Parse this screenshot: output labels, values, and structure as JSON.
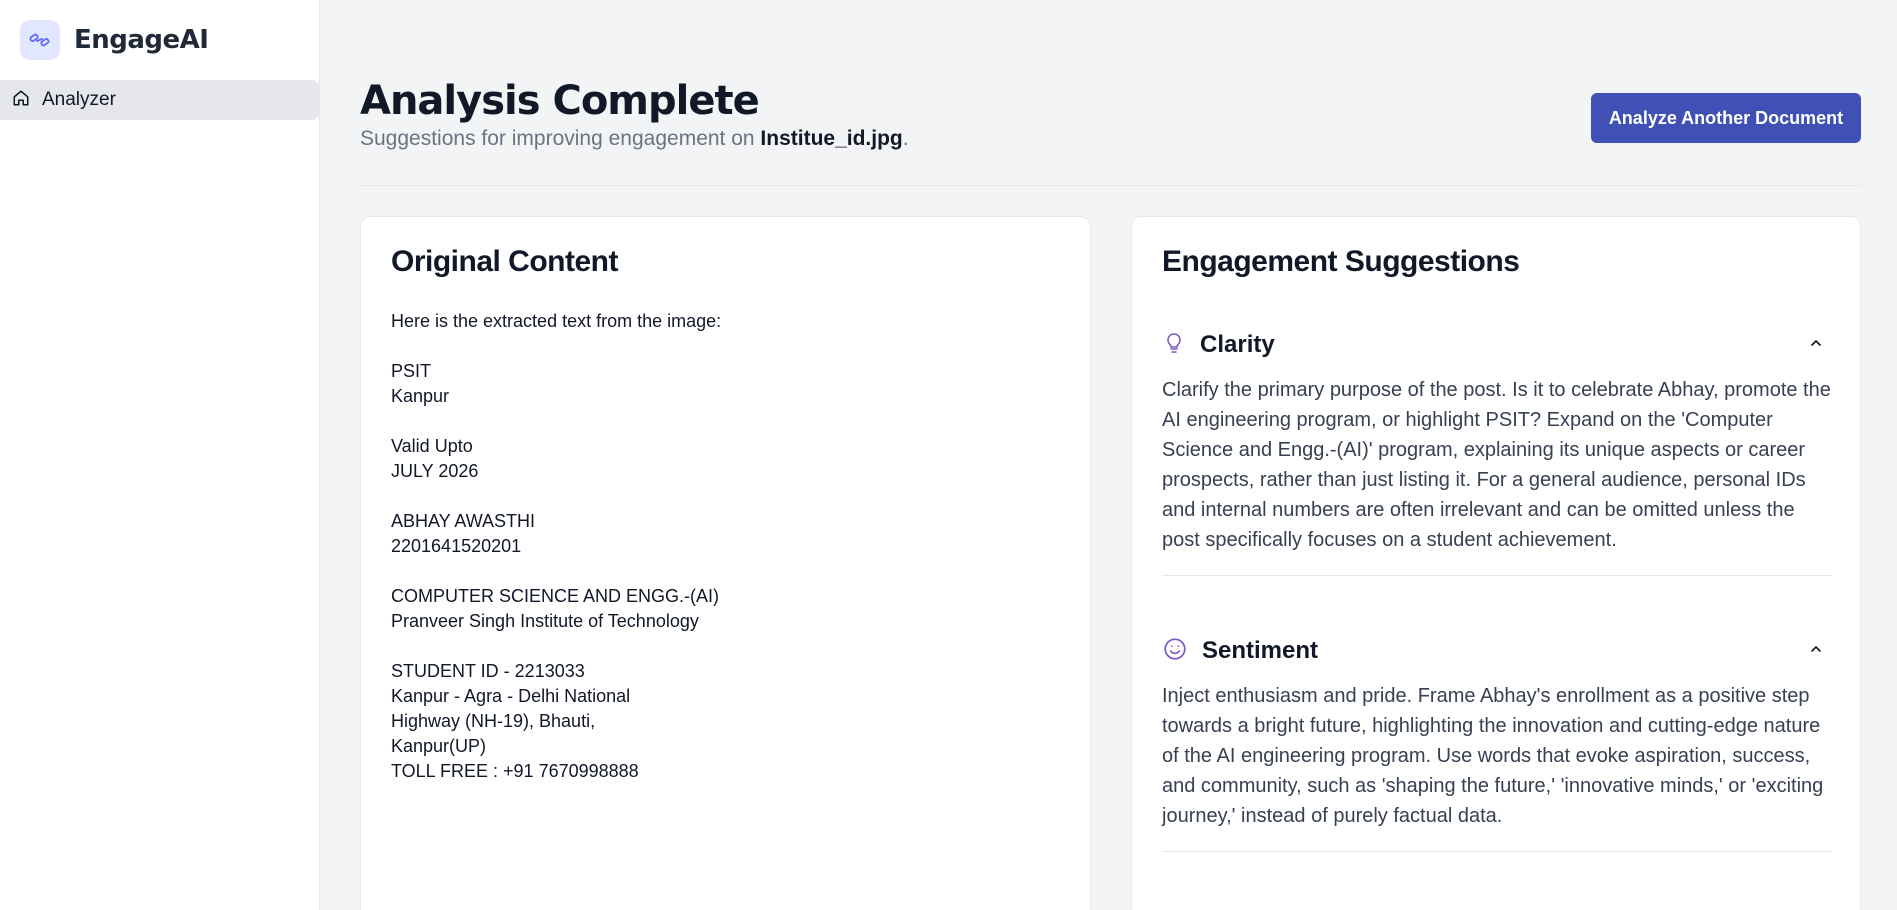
{
  "app": {
    "name": "EngageAI"
  },
  "sidebar": {
    "items": [
      {
        "label": "Analyzer",
        "icon": "home-icon"
      }
    ]
  },
  "header": {
    "title": "Analysis Complete",
    "subtitle_prefix": "Suggestions for improving engagement on ",
    "filename": "Institue_id.jpg",
    "subtitle_suffix": ".",
    "action_label": "Analyze Another Document"
  },
  "original": {
    "title": "Original Content",
    "intro": "Here is the extracted text from the image:",
    "blocks": [
      "PSIT\nKanpur",
      "Valid Upto\nJULY 2026",
      "ABHAY AWASTHI\n2201641520201",
      "COMPUTER SCIENCE AND ENGG.-(AI)\nPranveer Singh Institute of Technology",
      "STUDENT ID - 2213033\nKanpur - Agra - Delhi National\nHighway (NH-19), Bhauti,\nKanpur(UP)\nTOLL FREE : +91 7670998888"
    ]
  },
  "suggestions": {
    "title": "Engagement Suggestions",
    "items": [
      {
        "title": "Clarity",
        "icon": "lightbulb-icon",
        "body": "Clarify the primary purpose of the post. Is it to celebrate Abhay, promote the AI engineering program, or highlight PSIT? Expand on the 'Computer Science and Engg.-(AI)' program, explaining its unique aspects or career prospects, rather than just listing it. For a general audience, personal IDs and internal numbers are often irrelevant and can be omitted unless the post specifically focuses on a student achievement."
      },
      {
        "title": "Sentiment",
        "icon": "smile-icon",
        "body": "Inject enthusiasm and pride. Frame Abhay's enrollment as a positive step towards a bright future, highlighting the innovation and cutting-edge nature of the AI engineering program. Use words that evoke aspiration, success, and community, such as 'shaping the future,' 'innovative minds,' or 'exciting journey,' instead of purely factual data."
      }
    ]
  },
  "colors": {
    "accent": "#3f51b5",
    "icon_purple": "#7c5cc4",
    "sidebar_active": "#e5e7eb"
  }
}
